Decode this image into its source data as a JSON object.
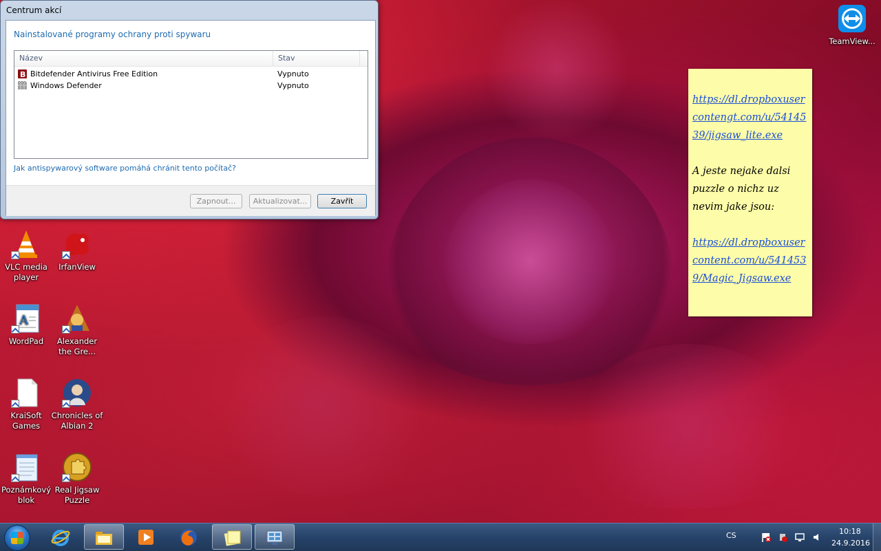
{
  "dialog": {
    "title": "Centrum akcí",
    "heading": "Nainstalované programy ochrany proti spywaru",
    "columns": {
      "name": "Název",
      "status": "Stav"
    },
    "rows": [
      {
        "name": "Bitdefender Antivirus Free Edition",
        "status": "Vypnuto",
        "icon": "bitdefender-icon"
      },
      {
        "name": "Windows Defender",
        "status": "Vypnuto",
        "icon": "windows-defender-icon"
      }
    ],
    "help_link": "Jak antispywarový software pomáhá chránit tento počítač?",
    "buttons": {
      "enable": "Zapnout...",
      "update": "Aktualizovat...",
      "close": "Zavřít"
    }
  },
  "desktop_icons": [
    {
      "label": "VLC media player",
      "icon": "vlc-icon"
    },
    {
      "label": "IrfanView",
      "icon": "irfanview-icon"
    },
    {
      "label": "WordPad",
      "icon": "wordpad-icon"
    },
    {
      "label": "Alexander the Gre...",
      "icon": "alexander-game-icon"
    },
    {
      "label": "KraiSoft Games",
      "icon": "file-icon"
    },
    {
      "label": "Chronicles of Albian 2",
      "icon": "chronicles-game-icon"
    },
    {
      "label": "Poznámkový blok",
      "icon": "notepad-icon"
    },
    {
      "label": "Real Jigsaw Puzzle",
      "icon": "puzzle-icon"
    },
    {
      "label": "TeamView...",
      "icon": "teamviewer-icon"
    }
  ],
  "sticky_note": {
    "link1": "https://dl.dropboxusercontengt.com/u/5414539/jigsaw_lite.exe",
    "text": "A jeste nejake dalsi puzzle o nichz uz nevim jake jsou:",
    "link2": "https://dl.dropboxusercontent.com/u/5414539/Magic_Jigsaw.exe"
  },
  "taskbar": {
    "language": "CS",
    "time": "10:18",
    "date": "24.9.2016"
  }
}
